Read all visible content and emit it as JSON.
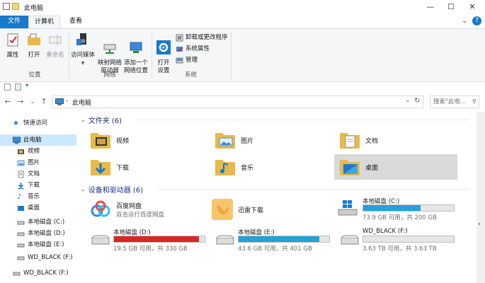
{
  "window": {
    "title": "此电脑",
    "minimize": "—",
    "maximize": "☐",
    "close": "✕"
  },
  "tabs": {
    "file": "文件",
    "computer": "计算机",
    "view": "查看"
  },
  "ribbon": {
    "location": {
      "label": "位置",
      "properties": "属性",
      "open": "打开",
      "rename": "重命名"
    },
    "network": {
      "label": "网络",
      "media": "访问媒体",
      "map_drive": "映射网络\n驱动器",
      "add_location": "添加一个\n网络位置"
    },
    "system": {
      "label": "系统",
      "open_settings": "打开\n设置",
      "uninstall": "卸载或更改程序",
      "sys_props": "系统属性",
      "manage": "管理"
    }
  },
  "address": {
    "crumb": "此电脑",
    "search_placeholder": "搜索\"此电...",
    "search_icon": "search-icon"
  },
  "nav": {
    "quick_access": "快速访问",
    "this_pc": "此电脑",
    "items": [
      "视频",
      "图片",
      "文档",
      "下载",
      "音乐",
      "桌面",
      "本地磁盘 (C:)",
      "本地磁盘 (D:)",
      "本地磁盘 (E:)",
      "WD_BLACK (F:)"
    ],
    "wd_black": "WD_BLACK (F:)"
  },
  "folders": {
    "header": "文件夹 (6)",
    "items": [
      "视频",
      "图片",
      "文档",
      "下载",
      "音乐",
      "桌面"
    ]
  },
  "devices": {
    "header": "设备和驱动器 (6)",
    "baidu": {
      "name": "百度网盘",
      "sub": "双击运行百度网盘"
    },
    "xunlei": {
      "name": "迅雷下载"
    },
    "c": {
      "name": "本地磁盘 (C:)",
      "free": "73.9 GB 可用，共 200 GB",
      "used_fraction": 0.63
    },
    "d": {
      "name": "本地磁盘 (D:)",
      "free": "19.5 GB 可用，共 330 GB",
      "used_fraction": 0.94
    },
    "e": {
      "name": "本地磁盘 (E:)",
      "free": "43.6 GB 可用，共 401 GB",
      "used_fraction": 0.89
    },
    "f": {
      "name": "WD_BLACK (F:)",
      "free": "3.63 TB 可用，共 3.63 TB",
      "used_fraction": 0.0
    }
  },
  "colors": {
    "accent": "#1979ca",
    "bar": "#26a0da",
    "bar_full": "#da2626"
  }
}
